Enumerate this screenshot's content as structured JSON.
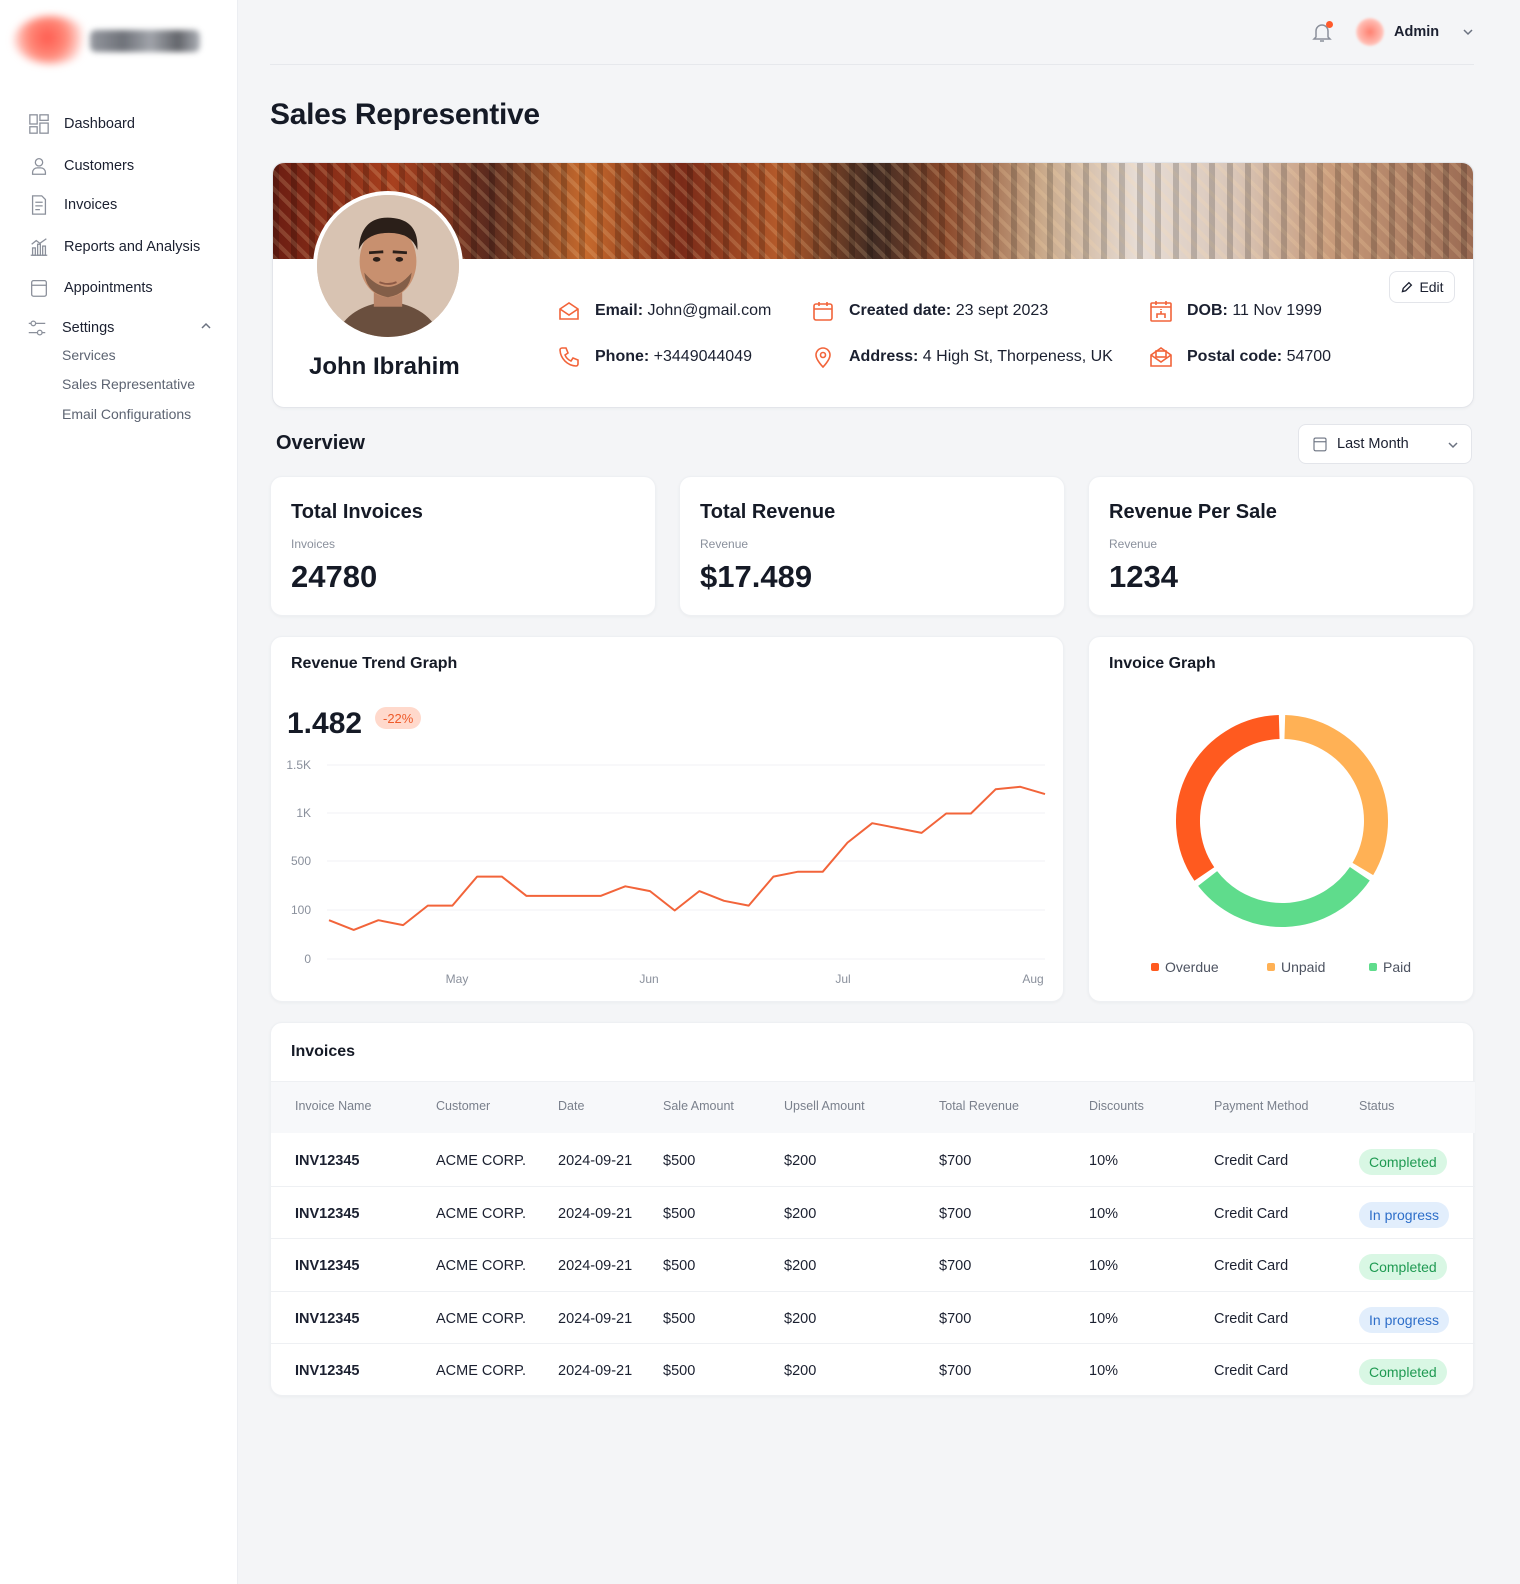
{
  "user": {
    "name": "Admin"
  },
  "sidebar": {
    "items": [
      {
        "label": "Dashboard",
        "icon": "dashboard-icon"
      },
      {
        "label": "Customers",
        "icon": "user-icon"
      },
      {
        "label": "Invoices",
        "icon": "document-icon"
      },
      {
        "label": "Reports and Analysis",
        "icon": "chart-icon"
      },
      {
        "label": "Appointments",
        "icon": "calendar-icon"
      },
      {
        "label": "Settings",
        "icon": "settings-sliders-icon"
      }
    ],
    "settings_sub": [
      "Services",
      "Sales Representative",
      "Email Configurations"
    ]
  },
  "page": {
    "title": "Sales Representive"
  },
  "profile": {
    "name": "John Ibrahim",
    "edit_label": "Edit",
    "email": {
      "label": "Email:",
      "value": " John@gmail.com"
    },
    "phone": {
      "label": "Phone:",
      "value": " +3449044049"
    },
    "created": {
      "label": "Created date:",
      "value": " 23 sept 2023"
    },
    "address": {
      "label": "Address:",
      "value": " 4 High St, Thorpeness,  UK"
    },
    "dob": {
      "label": "DOB:",
      "value": " 11 Nov 1999"
    },
    "postal": {
      "label": "Postal code:",
      "value": " 54700"
    }
  },
  "overview": {
    "title": "Overview",
    "period": "Last Month",
    "stats": [
      {
        "title": "Total Invoices",
        "sub": "Invoices",
        "value": "24780"
      },
      {
        "title": "Total Revenue",
        "sub": "Revenue",
        "value": "$17.489"
      },
      {
        "title": "Revenue Per Sale",
        "sub": "Revenue",
        "value": "1234"
      }
    ]
  },
  "revenue_trend": {
    "title": "Revenue Trend Graph",
    "value": "1.482",
    "change": "-22%"
  },
  "invoice_graph": {
    "title": "Invoice Graph"
  },
  "colors": {
    "accent": "#f2643a",
    "overdue": "#ff5a1f",
    "unpaid": "#ffb155",
    "paid": "#5fdc8c"
  },
  "chart_data": [
    {
      "type": "line",
      "title": "Revenue Trend Graph",
      "xlabel": "",
      "ylabel": "",
      "x_ticks": [
        "May",
        "Jun",
        "Jul",
        "Aug"
      ],
      "y_ticks": [
        "1.5K",
        "1K",
        "500",
        "100",
        "0"
      ],
      "series": [
        {
          "values": [
            80,
            60,
            80,
            70,
            110,
            110,
            170,
            170,
            130,
            130,
            130,
            130,
            150,
            140,
            100,
            140,
            120,
            110,
            170,
            180,
            180,
            240,
            280,
            270,
            260,
            300,
            300,
            350,
            355,
            340
          ]
        }
      ],
      "grid": true
    },
    {
      "type": "pie",
      "title": "Invoice Graph",
      "categories": [
        "Overdue",
        "Unpaid",
        "Paid"
      ],
      "values": [
        35,
        34,
        31
      ],
      "legend": "bottom"
    }
  ],
  "invoices": {
    "title": "Invoices",
    "columns": [
      "Invoice Name",
      "Customer",
      "Date",
      "Sale Amount",
      "Upsell Amount",
      "Total Revenue",
      "Discounts",
      "Payment Method",
      "Status"
    ],
    "rows": [
      [
        "INV12345",
        "ACME CORP.",
        "2024-09-21",
        "$500",
        "$200",
        "$700",
        "10%",
        "Credit Card",
        "Completed"
      ],
      [
        "INV12345",
        "ACME CORP.",
        "2024-09-21",
        "$500",
        "$200",
        "$700",
        "10%",
        "Credit Card",
        "In progress"
      ],
      [
        "INV12345",
        "ACME CORP.",
        "2024-09-21",
        "$500",
        "$200",
        "$700",
        "10%",
        "Credit Card",
        "Completed"
      ],
      [
        "INV12345",
        "ACME CORP.",
        "2024-09-21",
        "$500",
        "$200",
        "$700",
        "10%",
        "Credit Card",
        "In progress"
      ],
      [
        "INV12345",
        "ACME CORP.",
        "2024-09-21",
        "$500",
        "$200",
        "$700",
        "10%",
        "Credit Card",
        "Completed"
      ]
    ]
  }
}
